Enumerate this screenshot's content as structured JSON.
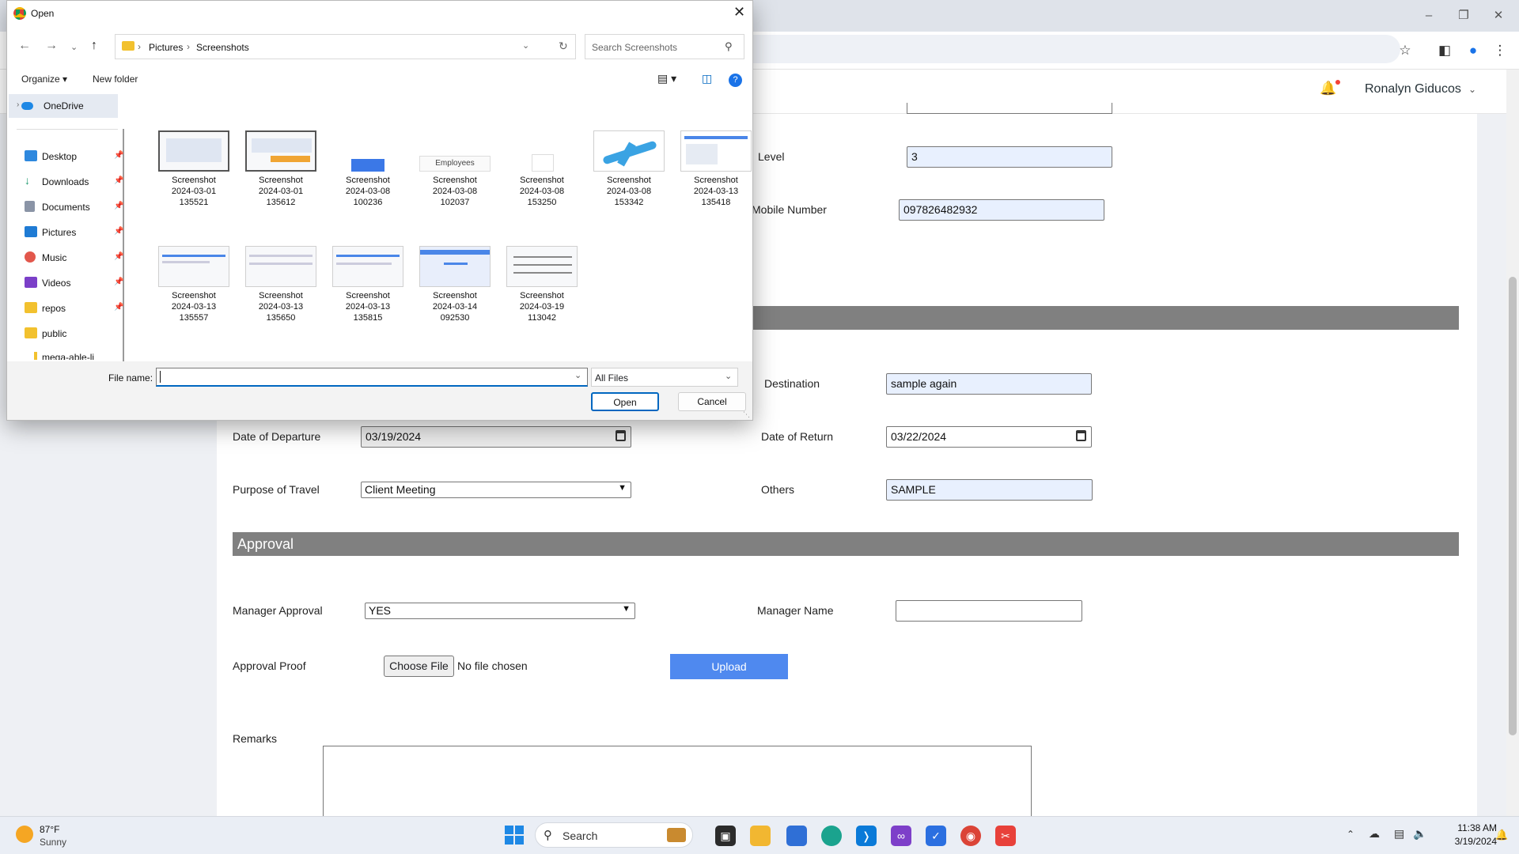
{
  "browser": {
    "user_name": "Ronalyn Giducos"
  },
  "form": {
    "level": {
      "label": "Level",
      "value": "3"
    },
    "mobile": {
      "label": "Mobile Number",
      "value": "097826482932"
    },
    "destination": {
      "label": "Destination",
      "value": "sample again"
    },
    "departure": {
      "label": "Date of Departure",
      "value": "03/19/2024"
    },
    "return": {
      "label": "Date of Return",
      "value": "03/22/2024"
    },
    "purpose": {
      "label": "Purpose of Travel",
      "value": "Client Meeting"
    },
    "others": {
      "label": "Others",
      "value": "SAMPLE"
    },
    "approval_section": "Approval",
    "manager_approval": {
      "label": "Manager Approval",
      "value": "YES"
    },
    "manager_name": {
      "label": "Manager Name",
      "value": ""
    },
    "approval_proof": {
      "label": "Approval Proof",
      "choose_label": "Choose File",
      "status": "No file chosen",
      "upload_label": "Upload"
    },
    "remarks": {
      "label": "Remarks"
    }
  },
  "dialog": {
    "title": "Open",
    "breadcrumb": [
      "Pictures",
      "Screenshots"
    ],
    "search_placeholder": "Search Screenshots",
    "organize": "Organize",
    "new_folder": "New folder",
    "nav": [
      {
        "label": "OneDrive",
        "icon": "onedrive-icon"
      },
      {
        "label": "Desktop",
        "icon": "desktop-icon"
      },
      {
        "label": "Downloads",
        "icon": "download-icon"
      },
      {
        "label": "Documents",
        "icon": "documents-icon"
      },
      {
        "label": "Pictures",
        "icon": "pictures-icon"
      },
      {
        "label": "Music",
        "icon": "music-icon"
      },
      {
        "label": "Videos",
        "icon": "videos-icon"
      },
      {
        "label": "repos",
        "icon": "folder-icon"
      },
      {
        "label": "public",
        "icon": "folder-icon"
      },
      {
        "label": "mega-able-lite",
        "icon": "folder-icon"
      }
    ],
    "files": [
      {
        "line1": "Screenshot",
        "line2": "2024-03-01",
        "line3": "135521"
      },
      {
        "line1": "Screenshot",
        "line2": "2024-03-01",
        "line3": "135612"
      },
      {
        "line1": "Screenshot",
        "line2": "2024-03-08",
        "line3": "100236"
      },
      {
        "line1": "Screenshot",
        "line2": "2024-03-08",
        "line3": "102037",
        "thumb_text": "Employees"
      },
      {
        "line1": "Screenshot",
        "line2": "2024-03-08",
        "line3": "153250"
      },
      {
        "line1": "Screenshot",
        "line2": "2024-03-08",
        "line3": "153342"
      },
      {
        "line1": "Screenshot",
        "line2": "2024-03-13",
        "line3": "135418"
      },
      {
        "line1": "Screenshot",
        "line2": "2024-03-13",
        "line3": "135557"
      },
      {
        "line1": "Screenshot",
        "line2": "2024-03-13",
        "line3": "135650"
      },
      {
        "line1": "Screenshot",
        "line2": "2024-03-13",
        "line3": "135815"
      },
      {
        "line1": "Screenshot",
        "line2": "2024-03-14",
        "line3": "092530"
      },
      {
        "line1": "Screenshot",
        "line2": "2024-03-19",
        "line3": "113042"
      }
    ],
    "file_name_label": "File name:",
    "file_name_value": "",
    "filter": "All Files",
    "open_label": "Open",
    "cancel_label": "Cancel"
  },
  "taskbar": {
    "weather_temp": "87°F",
    "weather_desc": "Sunny",
    "search_label": "Search",
    "time": "11:38 AM",
    "date": "3/19/2024"
  },
  "colors": {
    "accent": "#0067c0",
    "upload": "#4f89ef",
    "section": "#808080"
  }
}
